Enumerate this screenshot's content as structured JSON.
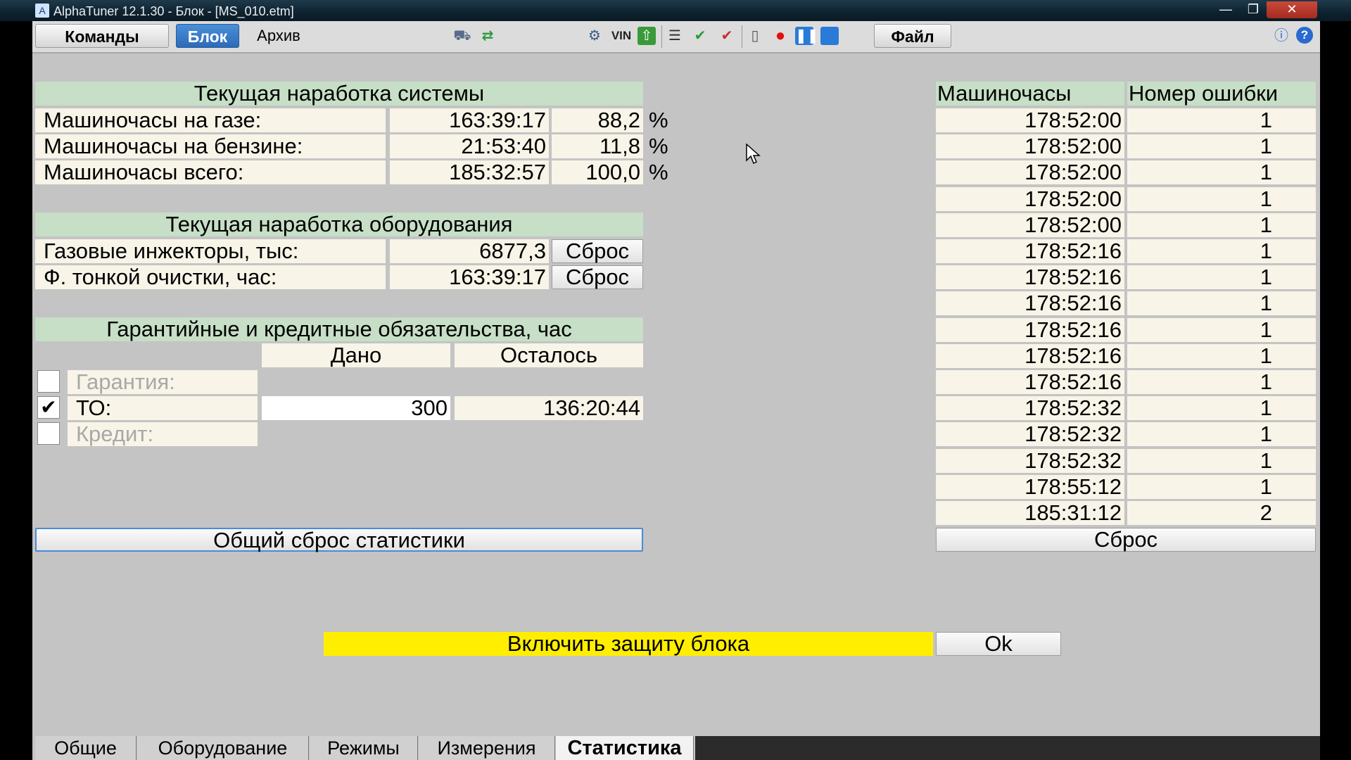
{
  "window": {
    "title": "AlphaTuner 12.1.30 - Блок - [MS_010.etm]",
    "min": "—",
    "max": "❐",
    "close": "✕"
  },
  "toolbar": {
    "commands": "Команды",
    "block": "Блок",
    "archive": "Архив",
    "vin": "VIN",
    "file": "Файл"
  },
  "system": {
    "header": "Текущая наработка системы",
    "rows": [
      {
        "label": "Машиночасы на газе:",
        "value": "163:39:17",
        "percent": "88,2",
        "unit": "%"
      },
      {
        "label": "Машиночасы на бензине:",
        "value": "21:53:40",
        "percent": "11,8",
        "unit": "%"
      },
      {
        "label": "Машиночасы всего:",
        "value": "185:32:57",
        "percent": "100,0",
        "unit": "%"
      }
    ]
  },
  "equipment": {
    "header": "Текущая наработка оборудования",
    "rows": [
      {
        "label": "Газовые инжекторы, тыс:",
        "value": "6877,3",
        "button": "Сброс"
      },
      {
        "label": "Ф. тонкой очистки, час:",
        "value": "163:39:17",
        "button": "Сброс"
      }
    ]
  },
  "warranty": {
    "header": "Гарантийные и кредитные обязательства, час",
    "col_given": "Дано",
    "col_left": "Осталось",
    "rows": [
      {
        "label": "Гарантия:",
        "checked": false,
        "given": "",
        "left": ""
      },
      {
        "label": "ТО:",
        "checked": true,
        "given": "300",
        "left": "136:20:44"
      },
      {
        "label": "Кредит:",
        "checked": false,
        "given": "",
        "left": ""
      }
    ],
    "check_mark": "✔"
  },
  "reset_all": "Общий сброс статистики",
  "errors": {
    "col_hours": "Машиночасы",
    "col_code": "Номер ошибки",
    "rows": [
      {
        "hours": "178:52:00",
        "code": "1"
      },
      {
        "hours": "178:52:00",
        "code": "1"
      },
      {
        "hours": "178:52:00",
        "code": "1"
      },
      {
        "hours": "178:52:00",
        "code": "1"
      },
      {
        "hours": "178:52:00",
        "code": "1"
      },
      {
        "hours": "178:52:16",
        "code": "1"
      },
      {
        "hours": "178:52:16",
        "code": "1"
      },
      {
        "hours": "178:52:16",
        "code": "1"
      },
      {
        "hours": "178:52:16",
        "code": "1"
      },
      {
        "hours": "178:52:16",
        "code": "1"
      },
      {
        "hours": "178:52:16",
        "code": "1"
      },
      {
        "hours": "178:52:32",
        "code": "1"
      },
      {
        "hours": "178:52:32",
        "code": "1"
      },
      {
        "hours": "178:52:32",
        "code": "1"
      },
      {
        "hours": "178:55:12",
        "code": "1"
      },
      {
        "hours": "185:31:12",
        "code": "2"
      }
    ],
    "reset": "Сброс"
  },
  "protect": {
    "label": "Включить защиту блока",
    "ok": "Ok",
    "color": "#ffee00"
  },
  "tabs": [
    "Общие",
    "Оборудование",
    "Режимы",
    "Измерения",
    "Статистика"
  ],
  "active_tab": "Статистика"
}
